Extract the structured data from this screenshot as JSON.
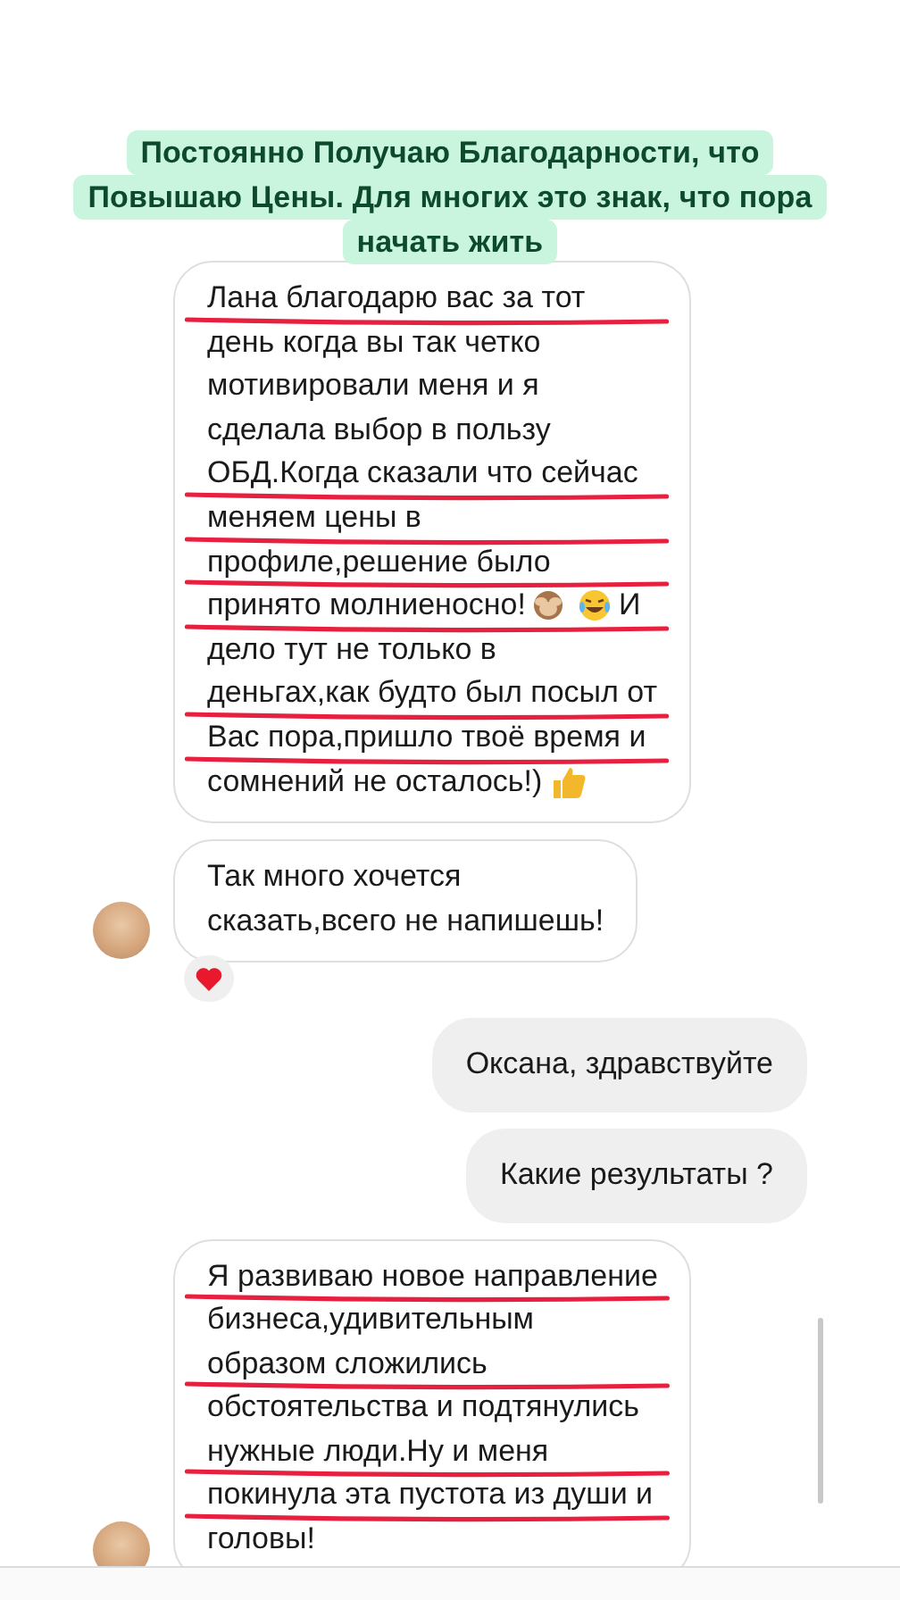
{
  "caption": {
    "lines": [
      "Постоянно Получаю Благодарности, что",
      "Повышаю Цены. Для многих это знак, что пора",
      "начать жить"
    ]
  },
  "messages": [
    {
      "kind": "incoming",
      "lines": [
        {
          "marked": true,
          "parts": [
            {
              "kind": "text",
              "text": "Лана благодарю вас за тот"
            }
          ]
        },
        {
          "marked": false,
          "parts": [
            {
              "kind": "text",
              "text": "день когда вы так четко"
            }
          ]
        },
        {
          "marked": false,
          "parts": [
            {
              "kind": "text",
              "text": "мотивировали меня и я"
            }
          ]
        },
        {
          "marked": false,
          "parts": [
            {
              "kind": "text",
              "text": "сделала выбор в пользу"
            }
          ]
        },
        {
          "marked": true,
          "parts": [
            {
              "kind": "text",
              "text": "ОБД.Когда сказали что сейчас"
            }
          ]
        },
        {
          "marked": true,
          "parts": [
            {
              "kind": "text",
              "text": "меняем цены в"
            }
          ]
        },
        {
          "marked": true,
          "parts": [
            {
              "kind": "text",
              "text": "профиле,решение было"
            }
          ]
        },
        {
          "marked": true,
          "parts": [
            {
              "kind": "text",
              "text": "принято молниеносно!"
            },
            {
              "kind": "monkey"
            },
            {
              "kind": "laugh"
            },
            {
              "kind": "text",
              "text": "И"
            }
          ]
        },
        {
          "marked": false,
          "parts": [
            {
              "kind": "text",
              "text": "дело тут не только в"
            }
          ]
        },
        {
          "marked": true,
          "parts": [
            {
              "kind": "text",
              "text": "деньгах,как будто был посыл от"
            }
          ]
        },
        {
          "marked": true,
          "parts": [
            {
              "kind": "text",
              "text": "Вас пора,пришло твоё время и"
            }
          ]
        },
        {
          "marked": false,
          "parts": [
            {
              "kind": "text",
              "text": "сомнений не осталось!)"
            },
            {
              "kind": "thumbs"
            }
          ]
        }
      ]
    },
    {
      "kind": "incoming",
      "avatar": true,
      "reacted": true,
      "lines": [
        {
          "marked": false,
          "parts": [
            {
              "kind": "text",
              "text": "Так много хочется"
            }
          ]
        },
        {
          "marked": false,
          "parts": [
            {
              "kind": "text",
              "text": "сказать,всего не напишешь!"
            }
          ]
        }
      ]
    },
    {
      "kind": "outgoing",
      "lines": [
        {
          "marked": false,
          "parts": [
            {
              "kind": "text",
              "text": "Оксана, здравствуйте"
            }
          ]
        }
      ]
    },
    {
      "kind": "outgoing",
      "lines": [
        {
          "marked": false,
          "parts": [
            {
              "kind": "text",
              "text": "Какие результаты ?"
            }
          ]
        }
      ]
    },
    {
      "kind": "incoming",
      "avatar": true,
      "lines": [
        {
          "marked": true,
          "parts": [
            {
              "kind": "text",
              "text": "Я развиваю новое направление"
            }
          ]
        },
        {
          "marked": false,
          "parts": [
            {
              "kind": "text",
              "text": "бизнеса,удивительным"
            }
          ]
        },
        {
          "marked": true,
          "parts": [
            {
              "kind": "text",
              "text": "образом сложились"
            }
          ]
        },
        {
          "marked": false,
          "parts": [
            {
              "kind": "text",
              "text": "обстоятельства и подтянулись"
            }
          ]
        },
        {
          "marked": true,
          "parts": [
            {
              "kind": "text",
              "text": "нужные люди.Ну и меня"
            }
          ]
        },
        {
          "marked": true,
          "parts": [
            {
              "kind": "text",
              "text": "покинула эта пустота из души и"
            }
          ]
        },
        {
          "marked": false,
          "parts": [
            {
              "kind": "text",
              "text": "головы!"
            }
          ]
        }
      ]
    }
  ]
}
